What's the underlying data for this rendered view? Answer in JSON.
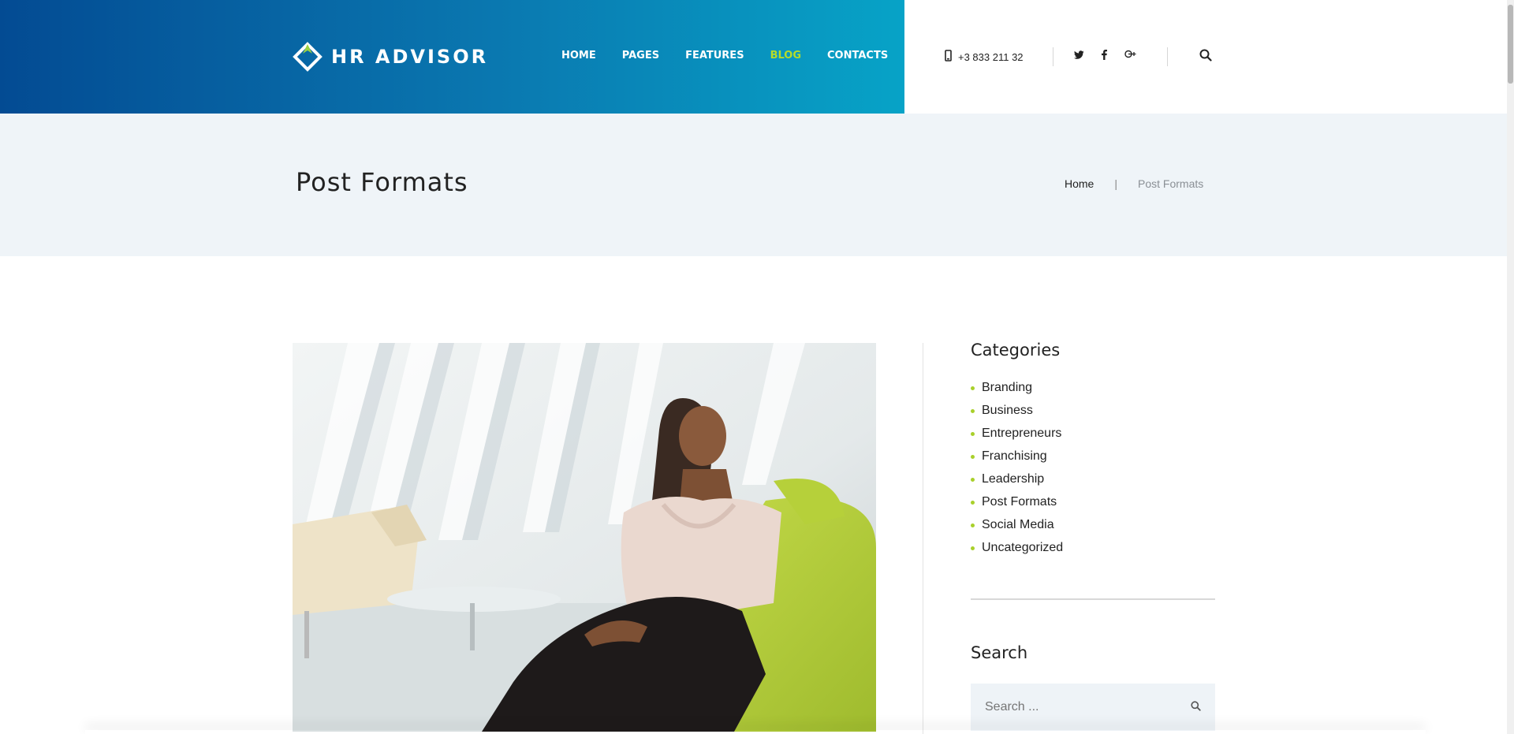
{
  "header": {
    "brand": "HR ADVISOR",
    "nav": [
      {
        "label": "HOME",
        "active": false
      },
      {
        "label": "PAGES",
        "active": false
      },
      {
        "label": "FEATURES",
        "active": false
      },
      {
        "label": "BLOG",
        "active": true
      },
      {
        "label": "CONTACTS",
        "active": false
      }
    ],
    "phone": "+3 833 211 32",
    "phone_icon": "mobile-phone-icon",
    "social_icons": [
      "twitter-icon",
      "facebook-icon",
      "google-plus-icon"
    ],
    "search_icon": "search-icon",
    "colors": {
      "accent": "#b4dc2a",
      "brand_dark": "#034b93",
      "brand_light": "#07a3c7"
    }
  },
  "page_header": {
    "title": "Post Formats",
    "breadcrumb": {
      "home": "Home",
      "separator": "|",
      "current": "Post Formats"
    }
  },
  "hero": {
    "image": "woman-sitting-on-green-sofa-photo"
  },
  "sidebar": {
    "categories": {
      "title": "Categories",
      "items": [
        "Branding",
        "Business",
        "Entrepreneurs",
        "Franchising",
        "Leadership",
        "Post Formats",
        "Social Media",
        "Uncategorized"
      ]
    },
    "search": {
      "title": "Search",
      "placeholder": "Search ..."
    }
  }
}
